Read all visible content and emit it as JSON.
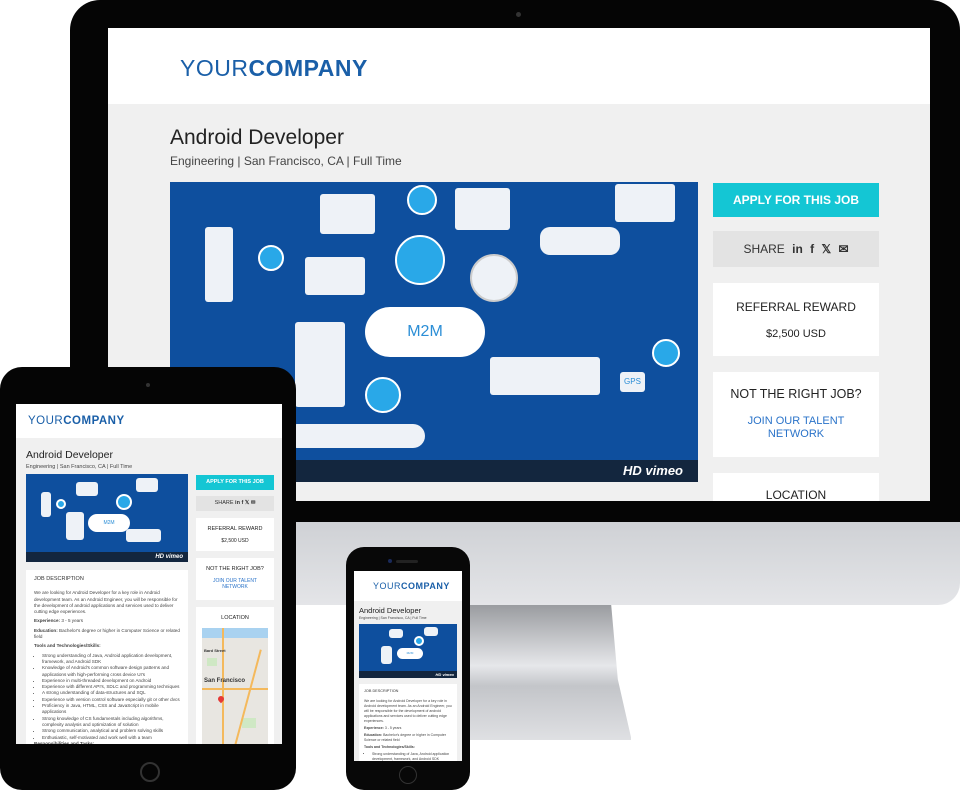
{
  "company": {
    "logo_light": "YOUR",
    "logo_bold": "COMPANY",
    "brand_color": "#1a5fa8",
    "accent_color": "#14c6d4"
  },
  "job": {
    "title": "Android Developer",
    "subtitle": "Engineering | San Francisco, CA | Full Time"
  },
  "video": {
    "center_label": "M2M",
    "hd_label": "HD",
    "provider": "vimeo",
    "gps_label": "GPS"
  },
  "sidebar": {
    "apply_label": "APPLY FOR THIS JOB",
    "share_label": "SHARE",
    "share_icons": [
      "linkedin-icon",
      "facebook-icon",
      "twitter-icon",
      "email-icon"
    ],
    "share_glyphs": {
      "linkedin": "in",
      "facebook": "f",
      "twitter": "🐦",
      "email": "✉"
    },
    "referral_title": "REFERRAL REWARD",
    "referral_value": "$2,500 USD",
    "not_right_title": "NOT THE RIGHT JOB?",
    "join_link_line1": "JOIN OUR TALENT",
    "join_link_line2": "NETWORK",
    "location_title": "LOCATION"
  },
  "map": {
    "city_label": "San Francisco",
    "street_label": "Bard Street"
  },
  "description": {
    "heading": "JOB DESCRIPTION",
    "intro": "We are looking for Android Developer for a key role in Android development team. As an Android Engineer, you will be responsible for the development of android applications and services used to deliver cutting edge experiences.",
    "experience_label": "Experience:",
    "experience_value": "3 - 5 years",
    "education_label": "Education:",
    "education_value": "Bachelor's degree or higher in Computer Science or related field",
    "skills_heading": "Tools and Technologies/Skills:",
    "skills": [
      "Strong understanding of Java, Android application development, framework, and Android SDK",
      "Knowledge of Android's common software design patterns and applications with high-performing cross device UI's",
      "Experience in multi-threaded development on Android",
      "Experience with different API's, SDLC and programming techniques",
      "A strong understanding of data-structures and SQL",
      "Experience with version control software especially git or other dvcs",
      "Proficiency in Java, HTML, CSS and JavaScript in mobile applications",
      "Strong knowledge of CS fundamentals including algorithms, complexity analysis and optimization of solution",
      "Strong communication, analytical and problem solving skills",
      "Enthusiastic, self-motivated and work well with a team"
    ],
    "responsibilities_heading": "Responsibilities and Tasks:"
  }
}
